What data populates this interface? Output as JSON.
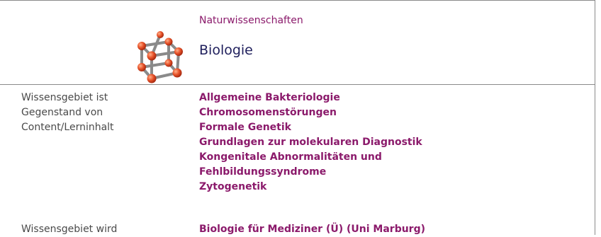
{
  "header": {
    "category": "Naturwissenschaften",
    "title": "Biologie",
    "logo_icon": "molecule-cube-icon"
  },
  "rows": [
    {
      "label_lines": [
        "Wissensgebiet ist",
        "Gegenstand von",
        "Content/Lerninhalt"
      ],
      "links": [
        "Allgemeine Bakteriologie",
        "Chromosomenstörungen",
        "Formale Genetik",
        "Grundlagen zur molekularen Diagnostik",
        "Kongenitale Abnormalitäten und",
        "Fehlbildungssyndrome",
        "Zytogenetik"
      ]
    },
    {
      "label_lines": [
        "Wissensgebiet wird"
      ],
      "links": [
        "Biologie für Mediziner (Ü) (Uni Marburg)"
      ]
    }
  ],
  "colors": {
    "link": "#8b1a6b",
    "title": "#1f1f5c",
    "border": "#8a8a8a",
    "atom": "#e8532a"
  }
}
